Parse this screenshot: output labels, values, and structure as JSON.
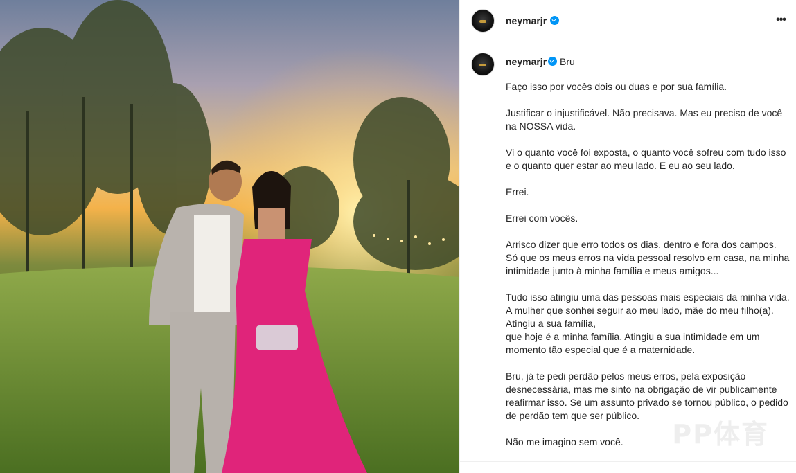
{
  "post": {
    "username": "neymarjr",
    "verified": true,
    "more_icon": "ellipsis-icon"
  },
  "caption": {
    "username": "neymarjr",
    "tagged": "Bru",
    "paragraphs": [
      "Faço isso por vocês dois ou duas e por sua família.",
      "Justificar o injustificável. Não precisava. Mas eu preciso de você na NOSSA vida.",
      "Vi o quanto você foi exposta, o quanto você sofreu com tudo isso e o quanto quer estar ao meu lado. E eu ao seu lado.",
      "Errei.",
      "Errei com vocês.",
      "Arrisco dizer que erro todos os dias, dentro e fora dos campos. Só que os meus erros na vida pessoal resolvo em casa, na minha intimidade junto à minha família e meus amigos...",
      "Tudo isso atingiu uma das pessoas mais especiais da minha vida. A mulher que sonhei seguir ao meu lado, mãe do meu filho(a). Atingiu a sua família,\nque hoje é a minha família. Atingiu a sua intimidade em um momento tão especial que é a maternidade.",
      "Bru, já te pedi perdão pelos meus erros, pela exposição desnecessária, mas me sinto na obrigação de vir publicamente reafirmar isso. Se um assunto privado se tornou público, o pedido de perdão tem que ser público.",
      "Não me imagino sem você."
    ]
  },
  "watermark": "PP体育",
  "colors": {
    "verified": "#0095f6",
    "dress": "#e0247a",
    "text": "#262626"
  }
}
